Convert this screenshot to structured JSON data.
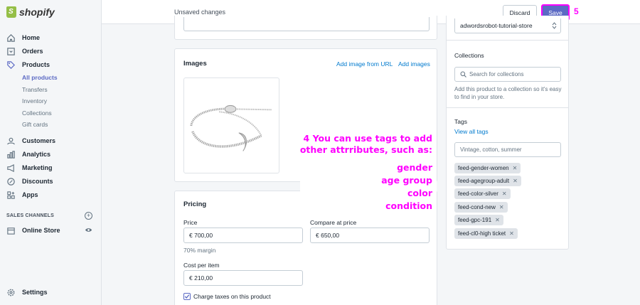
{
  "brand": {
    "name": "shopify"
  },
  "nav": {
    "home": "Home",
    "orders": "Orders",
    "products": "Products",
    "sub": [
      "All products",
      "Transfers",
      "Inventory",
      "Collections",
      "Gift cards"
    ],
    "customers": "Customers",
    "analytics": "Analytics",
    "marketing": "Marketing",
    "discounts": "Discounts",
    "apps": "Apps",
    "sales_channels": "SALES CHANNELS",
    "online_store": "Online Store",
    "settings": "Settings"
  },
  "topbar": {
    "unsaved": "Unsaved changes",
    "discard": "Discard",
    "save": "Save",
    "step": "5"
  },
  "images_card": {
    "title": "Images",
    "add_url": "Add image from URL",
    "add_images": "Add images"
  },
  "pricing": {
    "title": "Pricing",
    "price_label": "Price",
    "price_value": "€ 700,00",
    "compare_label": "Compare at price",
    "compare_value": "€ 650,00",
    "margin": "70% margin",
    "cost_label": "Cost per item",
    "cost_value": "€ 210,00",
    "charge_taxes": "Charge taxes on this product"
  },
  "right": {
    "store_select": "adwordsrobot-tutorial-store",
    "collections_title": "Collections",
    "collections_placeholder": "Search for collections",
    "collections_help": "Add this product to a collection so it's easy to find in your store.",
    "tags_title": "Tags",
    "view_all_tags": "View all tags",
    "tags_placeholder": "Vintage, cotton, summer",
    "tags": [
      "feed-gender-women",
      "feed-agegroup-adult",
      "feed-color-silver",
      "feed-cond-new",
      "feed-gpc-191",
      "feed-cl0-high ticket"
    ]
  },
  "annotation": {
    "line1": "4 You can use tags to add",
    "line2": "other attrributes, such as:",
    "items": [
      "gender",
      "age group",
      "color",
      "condition"
    ]
  },
  "colors": {
    "accent": "#5c6ac4",
    "link": "#007ace",
    "annotation": "#ff00ff",
    "brand_green": "#95bf47"
  }
}
